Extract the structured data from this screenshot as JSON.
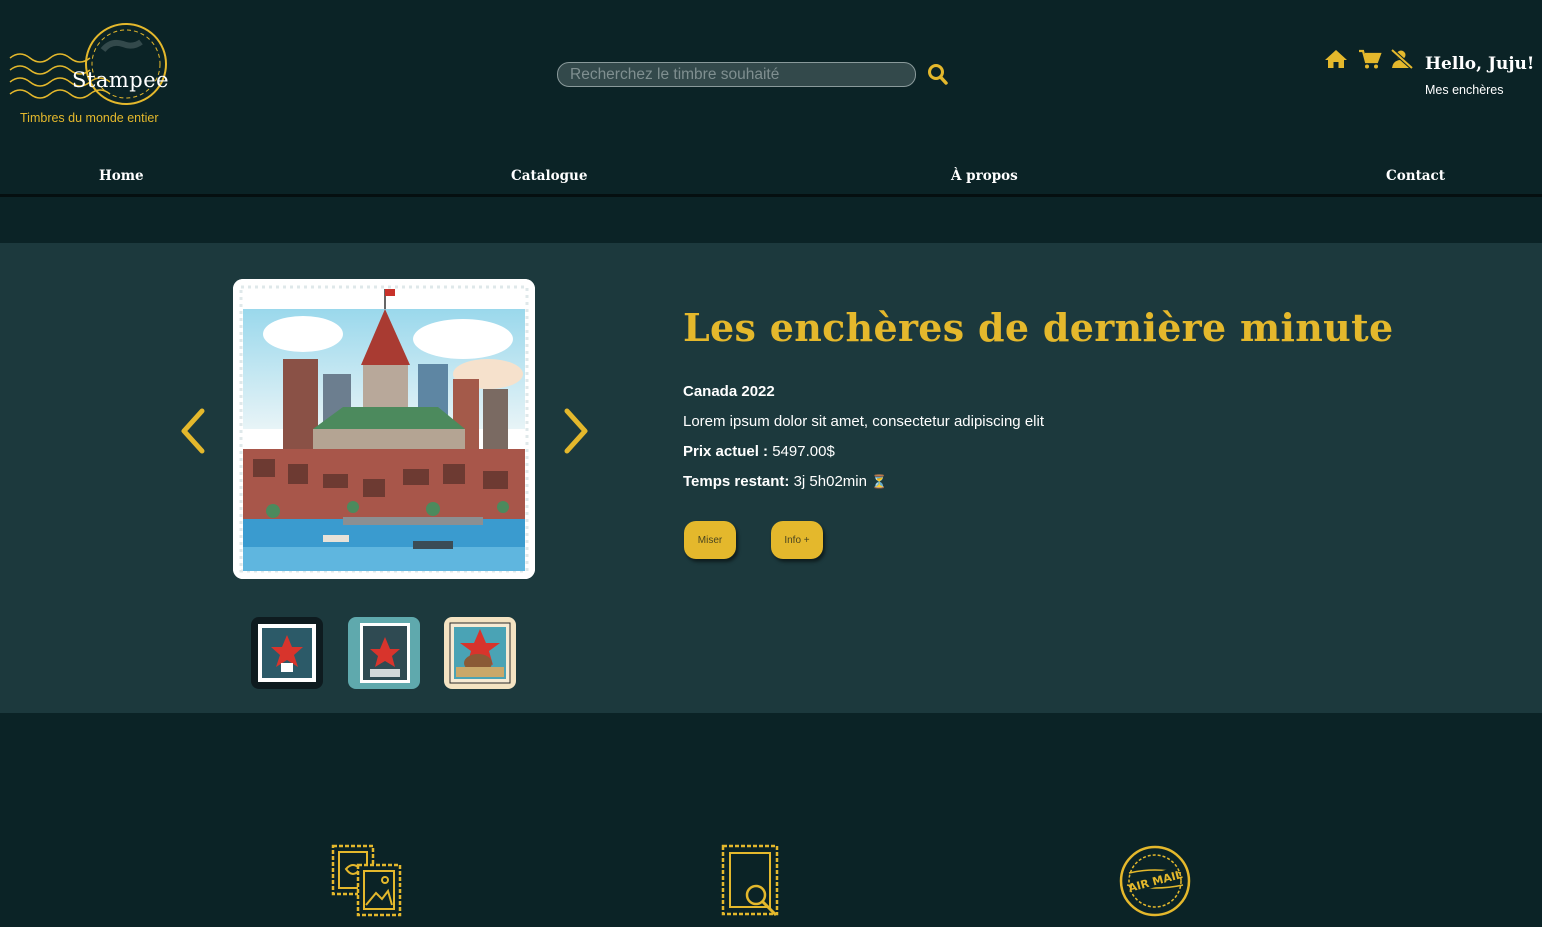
{
  "brand": {
    "name": "Stampee",
    "tagline": "Timbres du monde entier"
  },
  "search": {
    "placeholder": "Recherchez le timbre souhaité",
    "value": ""
  },
  "user": {
    "greeting": "Hello, Juju!",
    "my_auctions_label": "Mes enchères",
    "icons": [
      "home-icon",
      "cart-icon",
      "user-off-icon"
    ]
  },
  "nav": {
    "items": [
      {
        "label": "Home"
      },
      {
        "label": "Catalogue"
      },
      {
        "label": "À propos"
      },
      {
        "label": "Contact"
      }
    ]
  },
  "hero": {
    "title": "Les enchères de dernière minute",
    "stamp_name": "Canada 2022",
    "description": "Lorem ipsum dolor sit amet, consectetur adipiscing elit",
    "price_label": "Prix actuel :",
    "price_value": "5497.00$",
    "time_label": "Temps restant:",
    "time_value": "3j 5h02min",
    "time_icon": "⏳",
    "bid_button": "Miser",
    "info_button": "Info +",
    "thumbnails": [
      "canada-maple-stamp",
      "canada-teal-stamp",
      "canada-beaver-stamp"
    ]
  },
  "features": {
    "icons": [
      "stamp-collection-icon",
      "stamp-search-icon",
      "air-mail-seal-icon"
    ]
  },
  "colors": {
    "background": "#0b2326",
    "hero_background": "#1c393d",
    "accent": "#e4b82c",
    "text": "#ffffff"
  }
}
